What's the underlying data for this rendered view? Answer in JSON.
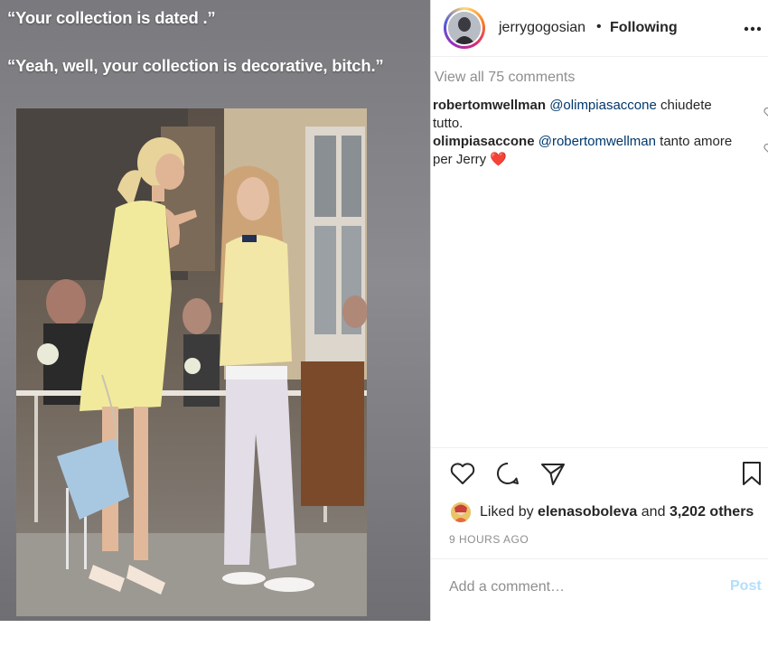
{
  "post": {
    "caption_line1": "“Your collection is dated .”",
    "caption_line2": "“Yeah, well, your collection is decorative, bitch.”"
  },
  "header": {
    "username": "jerrygogosian",
    "separator": "•",
    "follow_status": "Following",
    "more_icon": "more-horizontal-icon"
  },
  "comments": {
    "view_all": "View all 75 comments",
    "items": [
      {
        "user": "robertomwellman",
        "mention": "@olimpiasaccone",
        "text": " chiudete tutto."
      },
      {
        "user": "olimpiasaccone",
        "mention": "@robertomwellman",
        "text": " tanto amore per Jerry",
        "emoji": "❤️"
      }
    ]
  },
  "actions": {
    "like_icon": "heart-icon",
    "comment_icon": "comment-icon",
    "share_icon": "send-icon",
    "save_icon": "bookmark-icon"
  },
  "likes": {
    "prefix": "Liked by",
    "user": "elenasoboleva",
    "and": "and",
    "others": "3,202 others"
  },
  "timestamp": "9 HOURS AGO",
  "comment_box": {
    "placeholder": "Add a comment…",
    "post_label": "Post"
  },
  "colors": {
    "text": "#262626",
    "secondary": "#8e8e8e",
    "mention": "#00376b",
    "post_disabled": "#b2dffc"
  }
}
